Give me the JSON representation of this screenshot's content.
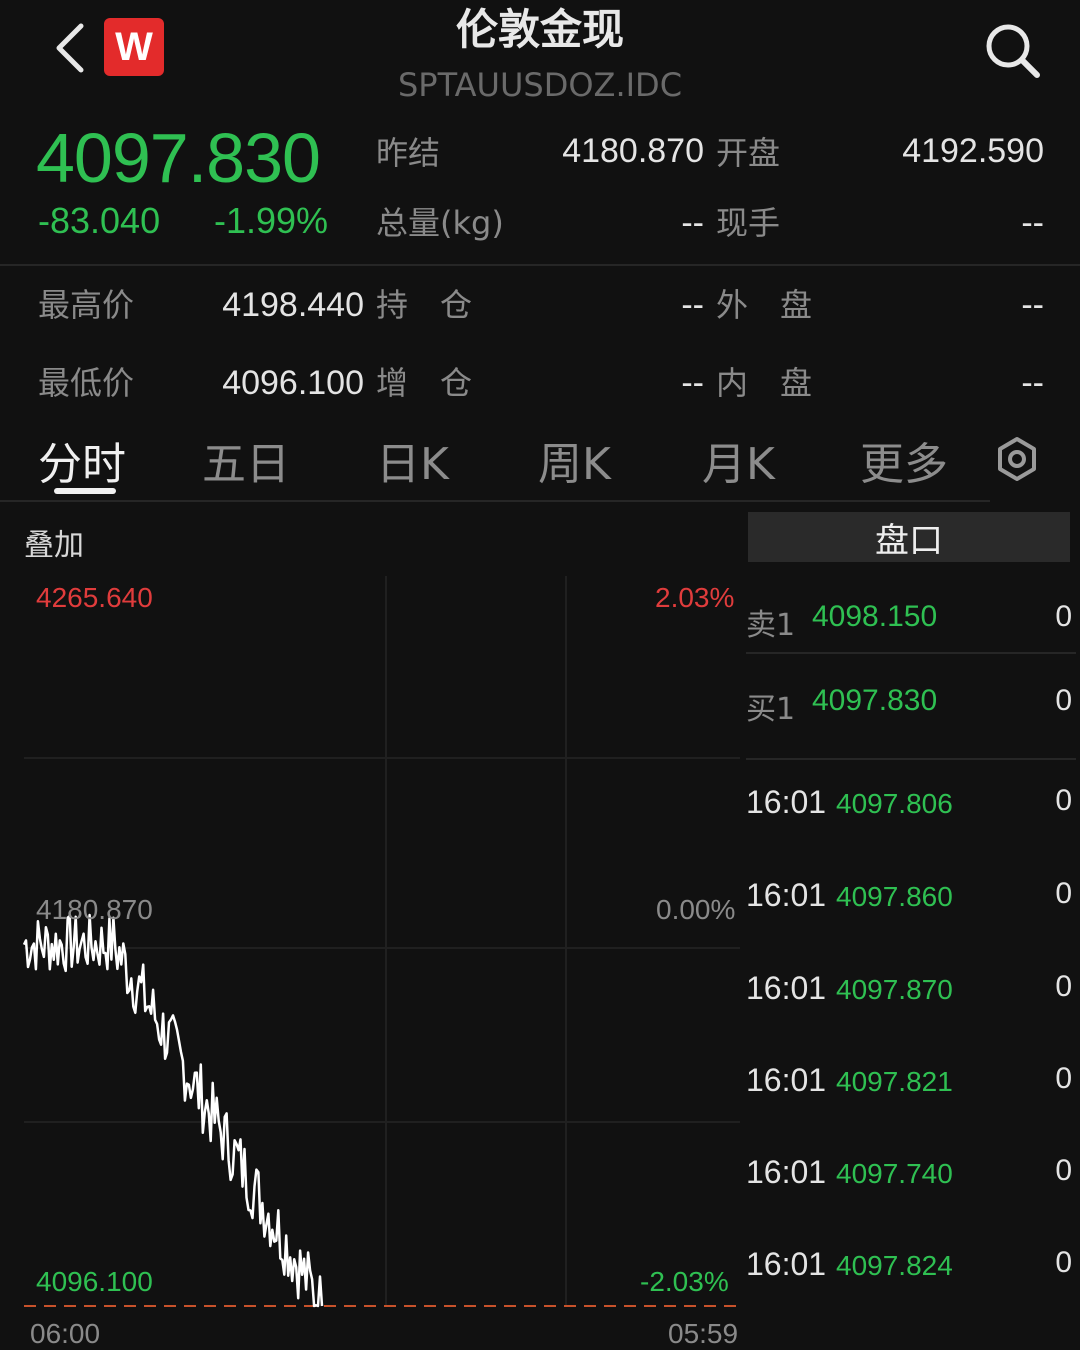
{
  "header": {
    "title": "伦敦金现",
    "code": "SPTAUUSDOZ.IDC",
    "logo_letter": "W"
  },
  "quote": {
    "price": "4097.830",
    "change": "-83.040",
    "change_pct": "-1.99%",
    "fields": [
      {
        "label": "昨结",
        "value": "4180.870"
      },
      {
        "label": "开盘",
        "value": "4192.590"
      },
      {
        "label": "总量(kg)",
        "value": "--"
      },
      {
        "label": "现手",
        "value": "--"
      },
      {
        "label": "最高价",
        "value": "4198.440"
      },
      {
        "label": "持　仓",
        "value": "--"
      },
      {
        "label": "外　盘",
        "value": "--"
      },
      {
        "label": "最低价",
        "value": "4096.100"
      },
      {
        "label": "增　仓",
        "value": "--"
      },
      {
        "label": "内　盘",
        "value": "--"
      }
    ]
  },
  "tabs": [
    {
      "label": "分时",
      "active": true
    },
    {
      "label": "五日",
      "active": false
    },
    {
      "label": "日K",
      "active": false
    },
    {
      "label": "周K",
      "active": false
    },
    {
      "label": "月K",
      "active": false
    },
    {
      "label": "更多",
      "active": false
    }
  ],
  "chart": {
    "overlay_label": "叠加",
    "panel_title": "盘口",
    "y_high": "4265.640",
    "y_mid": "4180.870",
    "y_low": "4096.100",
    "pct_high": "2.03%",
    "pct_mid": "0.00%",
    "pct_low": "-2.03%",
    "x_start": "06:00",
    "x_end": "05:59",
    "colors": {
      "up": "#e03c3c",
      "down": "#2fc052",
      "line": "#ffffff"
    }
  },
  "orderbook": [
    {
      "label": "卖1",
      "price": "4098.150",
      "volume": "0"
    },
    {
      "label": "买1",
      "price": "4097.830",
      "volume": "0"
    }
  ],
  "trades": [
    {
      "time": "16:01",
      "price": "4097.806",
      "volume": "0"
    },
    {
      "time": "16:01",
      "price": "4097.860",
      "volume": "0"
    },
    {
      "time": "16:01",
      "price": "4097.870",
      "volume": "0"
    },
    {
      "time": "16:01",
      "price": "4097.821",
      "volume": "0"
    },
    {
      "time": "16:01",
      "price": "4097.740",
      "volume": "0"
    },
    {
      "time": "16:01",
      "price": "4097.824",
      "volume": "0"
    }
  ],
  "icons": {
    "back": "chevron-left-icon",
    "search": "search-icon",
    "settings": "settings-icon"
  }
}
